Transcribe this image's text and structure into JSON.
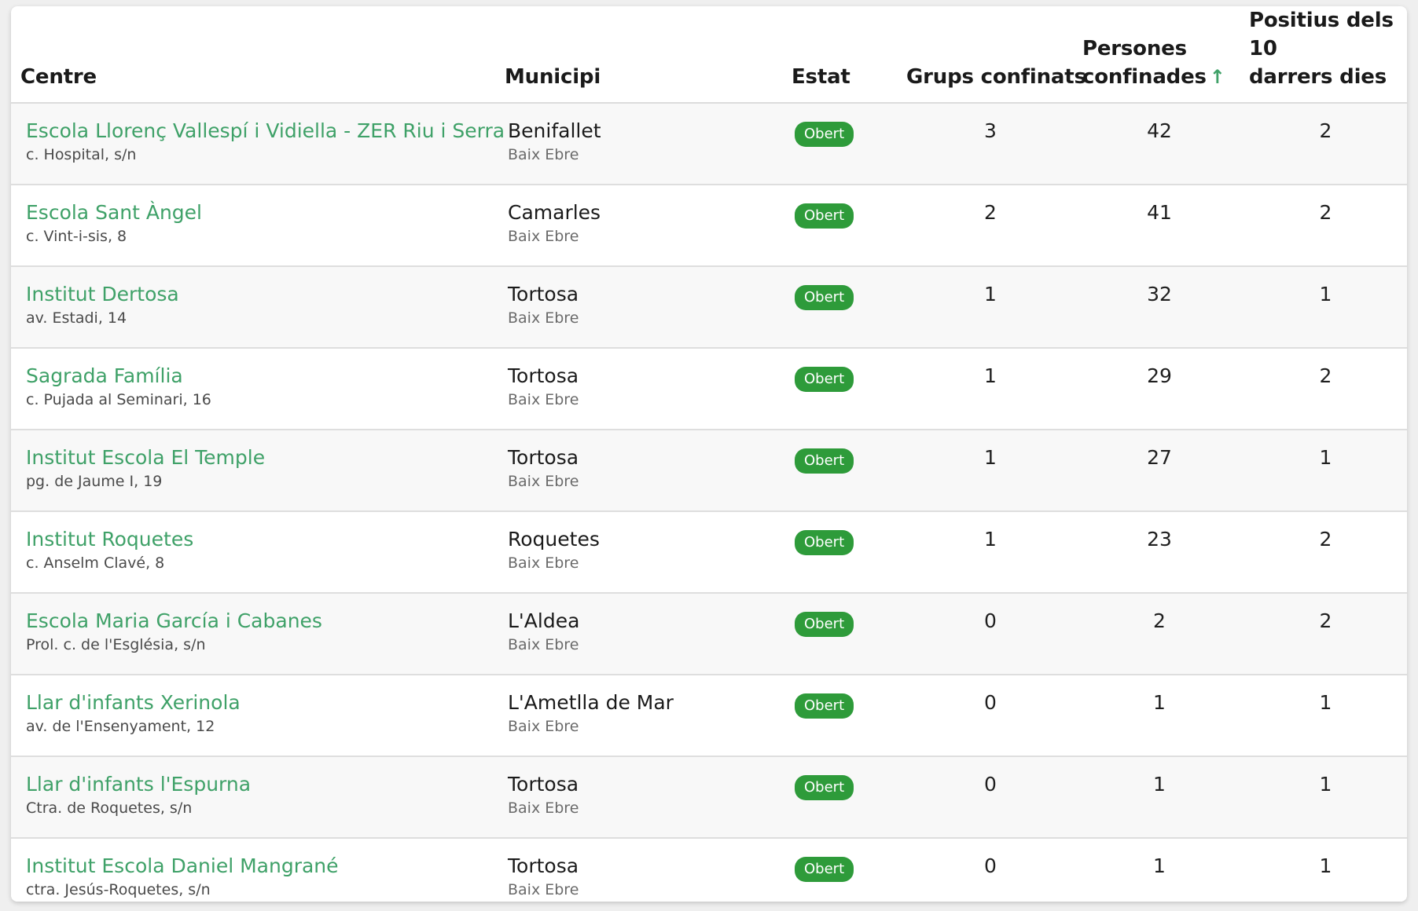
{
  "table": {
    "headers": {
      "centre": "Centre",
      "municipi": "Municipi",
      "estat": "Estat",
      "grups": "Grups confinats",
      "persones_line1": "Persones",
      "persones_line2": "confinades",
      "positius_line1": "Positius dels 10",
      "positius_line2": "darrers dies"
    },
    "sort_indicator": "↑",
    "rows": [
      {
        "name": "Escola Llorenç Vallespí i Vidiella - ZER Riu i Serra",
        "address": "c. Hospital, s/n",
        "municipi": "Benifallet",
        "comarca": "Baix Ebre",
        "estat": "Obert",
        "grups": "3",
        "persones": "42",
        "positius": "2"
      },
      {
        "name": "Escola Sant Àngel",
        "address": "c. Vint-i-sis, 8",
        "municipi": "Camarles",
        "comarca": "Baix Ebre",
        "estat": "Obert",
        "grups": "2",
        "persones": "41",
        "positius": "2"
      },
      {
        "name": "Institut Dertosa",
        "address": "av. Estadi, 14",
        "municipi": "Tortosa",
        "comarca": "Baix Ebre",
        "estat": "Obert",
        "grups": "1",
        "persones": "32",
        "positius": "1"
      },
      {
        "name": "Sagrada Família",
        "address": "c. Pujada al Seminari, 16",
        "municipi": "Tortosa",
        "comarca": "Baix Ebre",
        "estat": "Obert",
        "grups": "1",
        "persones": "29",
        "positius": "2"
      },
      {
        "name": "Institut Escola El Temple",
        "address": "pg. de Jaume I, 19",
        "municipi": "Tortosa",
        "comarca": "Baix Ebre",
        "estat": "Obert",
        "grups": "1",
        "persones": "27",
        "positius": "1"
      },
      {
        "name": "Institut Roquetes",
        "address": "c. Anselm Clavé, 8",
        "municipi": "Roquetes",
        "comarca": "Baix Ebre",
        "estat": "Obert",
        "grups": "1",
        "persones": "23",
        "positius": "2"
      },
      {
        "name": "Escola Maria García i Cabanes",
        "address": "Prol. c. de l'Església, s/n",
        "municipi": "L'Aldea",
        "comarca": "Baix Ebre",
        "estat": "Obert",
        "grups": "0",
        "persones": "2",
        "positius": "2"
      },
      {
        "name": "Llar d'infants Xerinola",
        "address": "av. de l'Ensenyament, 12",
        "municipi": "L'Ametlla de Mar",
        "comarca": "Baix Ebre",
        "estat": "Obert",
        "grups": "0",
        "persones": "1",
        "positius": "1"
      },
      {
        "name": "Llar d'infants l'Espurna",
        "address": "Ctra. de Roquetes, s/n",
        "municipi": "Tortosa",
        "comarca": "Baix Ebre",
        "estat": "Obert",
        "grups": "0",
        "persones": "1",
        "positius": "1"
      },
      {
        "name": "Institut Escola Daniel Mangrané",
        "address": "ctra. Jesús-Roquetes, s/n",
        "municipi": "Tortosa",
        "comarca": "Baix Ebre",
        "estat": "Obert",
        "grups": "0",
        "persones": "1",
        "positius": "1"
      }
    ]
  },
  "colors": {
    "link": "#3fa168",
    "badge": "#2e9b3a",
    "sort_arrow": "#3fa168"
  }
}
